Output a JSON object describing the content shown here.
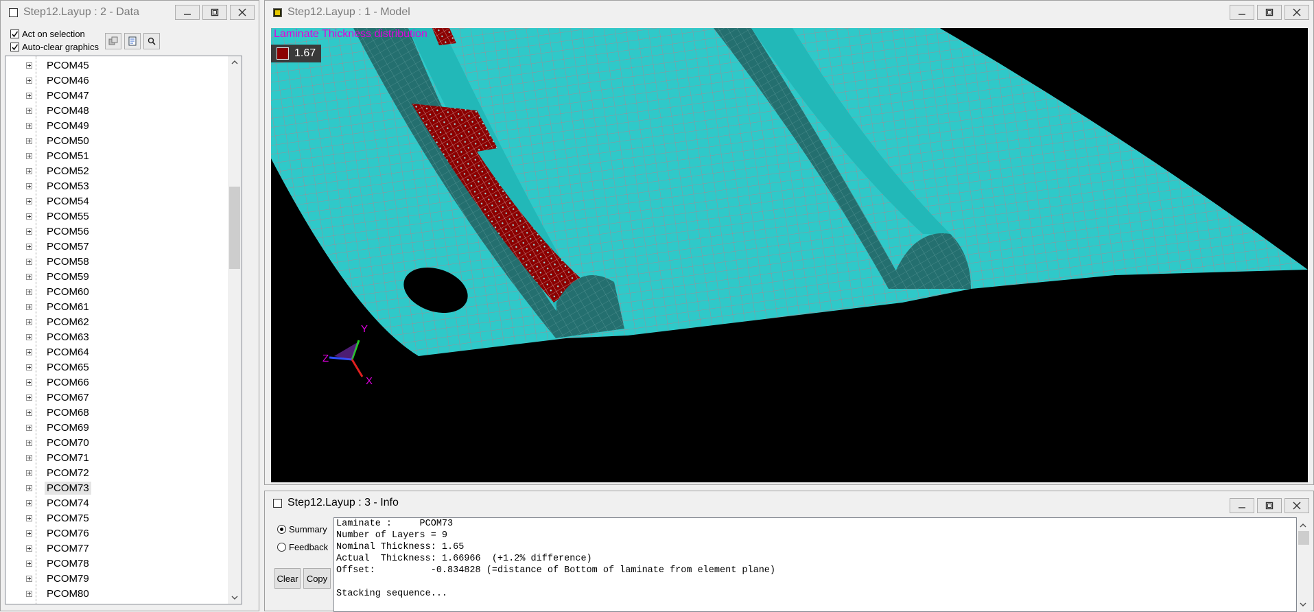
{
  "data_window": {
    "title": "Step12.Layup : 2 - Data",
    "act_on_selection": "Act on selection",
    "auto_clear_graphics": "Auto-clear graphics",
    "tree_items": [
      "PCOM45",
      "PCOM46",
      "PCOM47",
      "PCOM48",
      "PCOM49",
      "PCOM50",
      "PCOM51",
      "PCOM52",
      "PCOM53",
      "PCOM54",
      "PCOM55",
      "PCOM56",
      "PCOM57",
      "PCOM58",
      "PCOM59",
      "PCOM60",
      "PCOM61",
      "PCOM62",
      "PCOM63",
      "PCOM64",
      "PCOM65",
      "PCOM66",
      "PCOM67",
      "PCOM68",
      "PCOM69",
      "PCOM70",
      "PCOM71",
      "PCOM72",
      "PCOM73",
      "PCOM74",
      "PCOM75",
      "PCOM76",
      "PCOM77",
      "PCOM78",
      "PCOM79",
      "PCOM80"
    ],
    "selected_item": "PCOM73"
  },
  "model_window": {
    "title": "Step12.Layup : 1 - Model",
    "plot_title": "Laminate Thickness distribution",
    "legend_value": "1.67",
    "legend_color": "#8b0000",
    "mesh_color": "#2fc9c9",
    "axes": {
      "x": "X",
      "y": "Y",
      "z": "Z"
    }
  },
  "info_window": {
    "title": "Step12.Layup : 3 - Info",
    "radio_summary": "Summary",
    "radio_feedback": "Feedback",
    "clear_label": "Clear",
    "copy_label": "Copy",
    "lines": [
      "Laminate :     PCOM73",
      "Number of Layers = 9",
      "Nominal Thickness: 1.65",
      "Actual  Thickness: 1.66966  (+1.2% difference)",
      "Offset:          -0.834828 (=distance of Bottom of laminate from element plane)",
      "",
      "Stacking sequence..."
    ]
  }
}
